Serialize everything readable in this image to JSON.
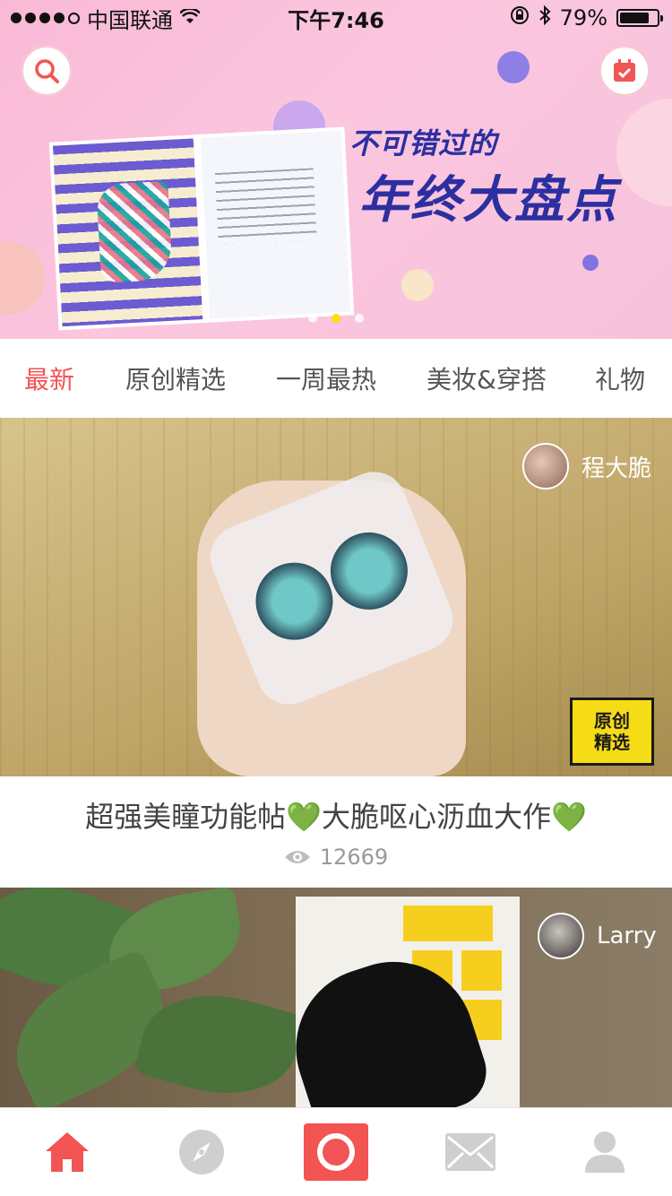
{
  "status_bar": {
    "carrier": "中国联通",
    "time": "下午7:46",
    "battery_percent": "79%",
    "battery_level": 0.79,
    "signal_bars_filled": 4,
    "signal_bars_total": 5
  },
  "banner": {
    "title_line1": "不可错过的",
    "title_line2": "年终大盘点",
    "active_page": 1,
    "page_count": 3,
    "search_icon": "search-icon",
    "calendar_icon": "calendar-icon"
  },
  "tabs": {
    "items": [
      "最新",
      "原创精选",
      "一周最热",
      "美妆&穿搭",
      "礼物"
    ],
    "active_index": 0,
    "active_color": "#f25454"
  },
  "posts": [
    {
      "author": "程大脆",
      "title": "超强美瞳功能帖💚大脆呕心沥血大作💚",
      "views": "12669",
      "badge_line1": "原创",
      "badge_line2": "精选"
    },
    {
      "author": "Larry"
    }
  ],
  "bottom_nav": {
    "items": [
      "home-icon",
      "compass-icon",
      "camera-record-icon",
      "mail-icon",
      "profile-icon"
    ],
    "active_color": "#f25454",
    "inactive_color": "#cfcfcf"
  }
}
